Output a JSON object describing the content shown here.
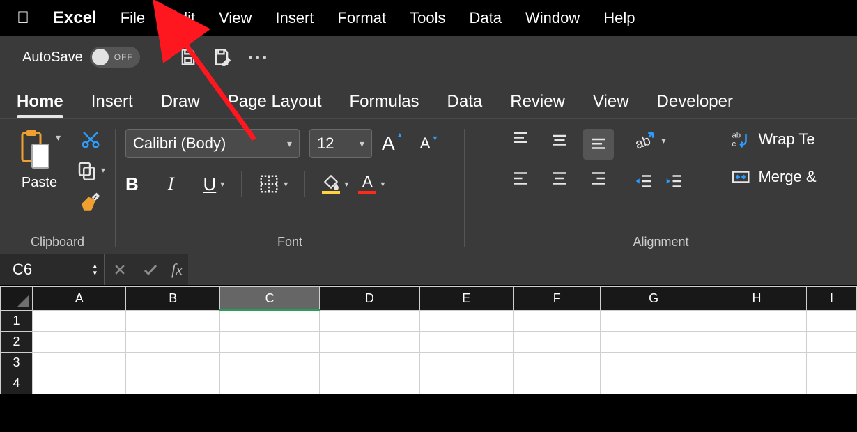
{
  "mac_menu": {
    "app": "Excel",
    "items": [
      "File",
      "Edit",
      "View",
      "Insert",
      "Format",
      "Tools",
      "Data",
      "Window",
      "Help"
    ]
  },
  "qat": {
    "autosave_label": "AutoSave",
    "autosave_state": "OFF"
  },
  "ribbon": {
    "tabs": [
      "Home",
      "Insert",
      "Draw",
      "Page Layout",
      "Formulas",
      "Data",
      "Review",
      "View",
      "Developer"
    ],
    "active_tab": "Home",
    "groups": {
      "clipboard": {
        "label": "Clipboard",
        "paste": "Paste"
      },
      "font": {
        "label": "Font",
        "font_name": "Calibri (Body)",
        "font_size": "12",
        "bold": "B",
        "italic": "I",
        "underline": "U"
      },
      "alignment": {
        "label": "Alignment",
        "wrap": "Wrap Te",
        "merge": "Merge &"
      }
    }
  },
  "formula_bar": {
    "name_box": "C6",
    "fx_label": "fx",
    "formula": ""
  },
  "sheet": {
    "columns": [
      "A",
      "B",
      "C",
      "D",
      "E",
      "F",
      "G",
      "H",
      "I"
    ],
    "selected_column": "C",
    "rows": [
      "1",
      "2",
      "3",
      "4"
    ],
    "active_cell": "C6"
  },
  "annotation": {
    "arrow_points_to": "File menu"
  },
  "colors": {
    "fill_underline": "#ffd23f",
    "font_color_underline": "#ff2a1a",
    "arrow": "#ff1720",
    "accent_blue": "#2d9cff"
  }
}
